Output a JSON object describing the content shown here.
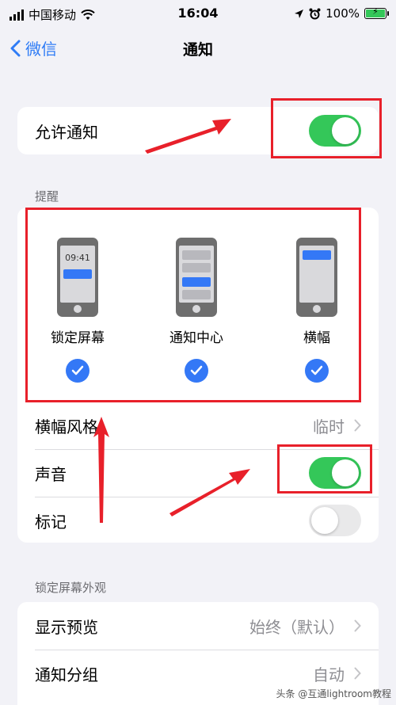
{
  "status_bar": {
    "carrier": "中国移动",
    "time": "16:04",
    "battery": "100%"
  },
  "nav": {
    "back_label": "微信",
    "title": "通知"
  },
  "allow": {
    "label": "允许通知",
    "enabled": true
  },
  "alerts": {
    "header": "提醒",
    "options": [
      {
        "label": "锁定屏幕",
        "checked": true,
        "preview_time": "09:41"
      },
      {
        "label": "通知中心",
        "checked": true
      },
      {
        "label": "横幅",
        "checked": true
      }
    ]
  },
  "settings": {
    "banner_style_label": "横幅风格",
    "banner_style_value": "临时",
    "sounds_label": "声音",
    "sounds_enabled": true,
    "badges_label": "标记",
    "badges_enabled": false
  },
  "lock_screen": {
    "header": "锁定屏幕外观",
    "show_previews_label": "显示预览",
    "show_previews_value": "始终（默认）",
    "grouping_label": "通知分组",
    "grouping_value": "自动"
  },
  "watermark": "头条 @互通lightroom教程",
  "colors": {
    "accent": "#3478f6",
    "toggle_on": "#34c759",
    "annotation": "#e8202a"
  }
}
